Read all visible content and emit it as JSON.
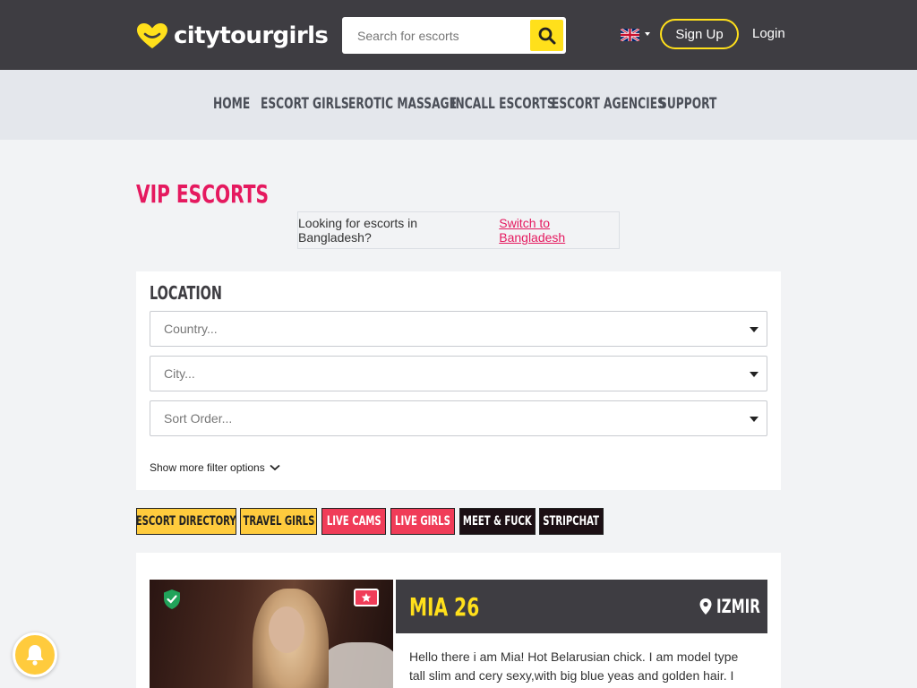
{
  "header": {
    "logo_part1": "city",
    "logo_part2": "tour",
    "logo_part3": "girls",
    "search_placeholder": "Search for escorts",
    "language_icon": "uk-flag-icon",
    "signup_label": "Sign Up",
    "login_label": "Login",
    "brand_color": "#ffe01b",
    "bar_color": "#3e3d42"
  },
  "nav": {
    "items": [
      "HOME",
      "ESCORT GIRLS",
      "EROTIC MASSAGE",
      "INCALL ESCORTS",
      "ESCORT AGENCIES",
      "SUPPORT"
    ]
  },
  "page": {
    "title": "VIP ESCORTS",
    "accent_color": "#e5195f",
    "notice_text": "Looking for escorts in Bangladesh?",
    "notice_link": "Switch to Bangladesh"
  },
  "filters": {
    "title": "LOCATION",
    "country_placeholder": "Country...",
    "city_placeholder": "City...",
    "sort_placeholder": "Sort Order...",
    "more_label": "Show more filter options"
  },
  "tags": [
    {
      "label": "ESCORT DIRECTORY",
      "style": "yellow"
    },
    {
      "label": "TRAVEL GIRLS",
      "style": "yellow"
    },
    {
      "label": "LIVE CAMS",
      "style": "red"
    },
    {
      "label": "LIVE GIRLS",
      "style": "red"
    },
    {
      "label": "MEET & FUCK",
      "style": "black"
    },
    {
      "label": "STRIPCHAT",
      "style": "black"
    }
  ],
  "listing": {
    "name": "MIA 26",
    "city": "IZMIR",
    "description": "Hello there i am Mia! Hot Belarusian chick. I am model type tall slim and cery sexy,with big blue yeas and golden hair. I am very",
    "verified_icon": "verified-shield-icon",
    "favorite_icon": "star-icon",
    "location_icon": "map-pin-icon"
  },
  "notification_icon": "bell-icon"
}
